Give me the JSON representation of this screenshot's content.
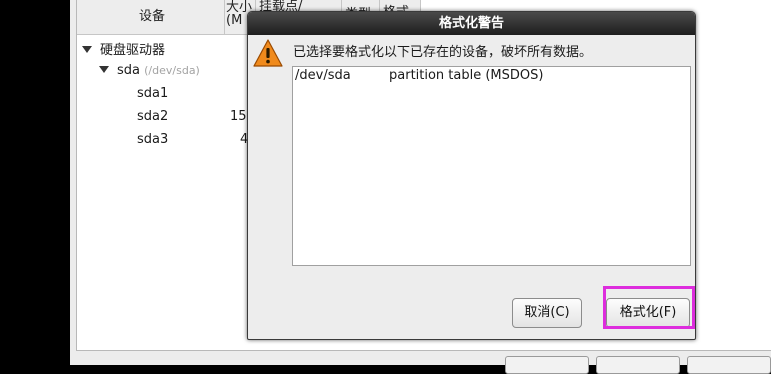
{
  "table": {
    "headers": {
      "device": "设备",
      "size_line1": "大小",
      "size_line2": "(M",
      "mount": "挂载点/",
      "type": "类型",
      "format": "格式"
    },
    "tree": {
      "group_label": "硬盘驱动器",
      "disk_label": "sda",
      "disk_path": "(/dev/sda)",
      "partitions": [
        {
          "name": "sda1",
          "size": ""
        },
        {
          "name": "sda2",
          "size": "15"
        },
        {
          "name": "sda3",
          "size": "4"
        }
      ]
    }
  },
  "dialog": {
    "title": "格式化警告",
    "icon": "warning-icon",
    "message": "已选择要格式化以下已存在的设备，破坏所有数据。",
    "devices": [
      {
        "device": "/dev/sda",
        "description": "partition table (MSDOS)"
      }
    ],
    "cancel_label": "取消(C)",
    "format_label": "格式化(F)"
  },
  "colors": {
    "highlight": "#dd2ddd",
    "warning": "#f08a1c",
    "titlebar": "#2a2a2a"
  }
}
